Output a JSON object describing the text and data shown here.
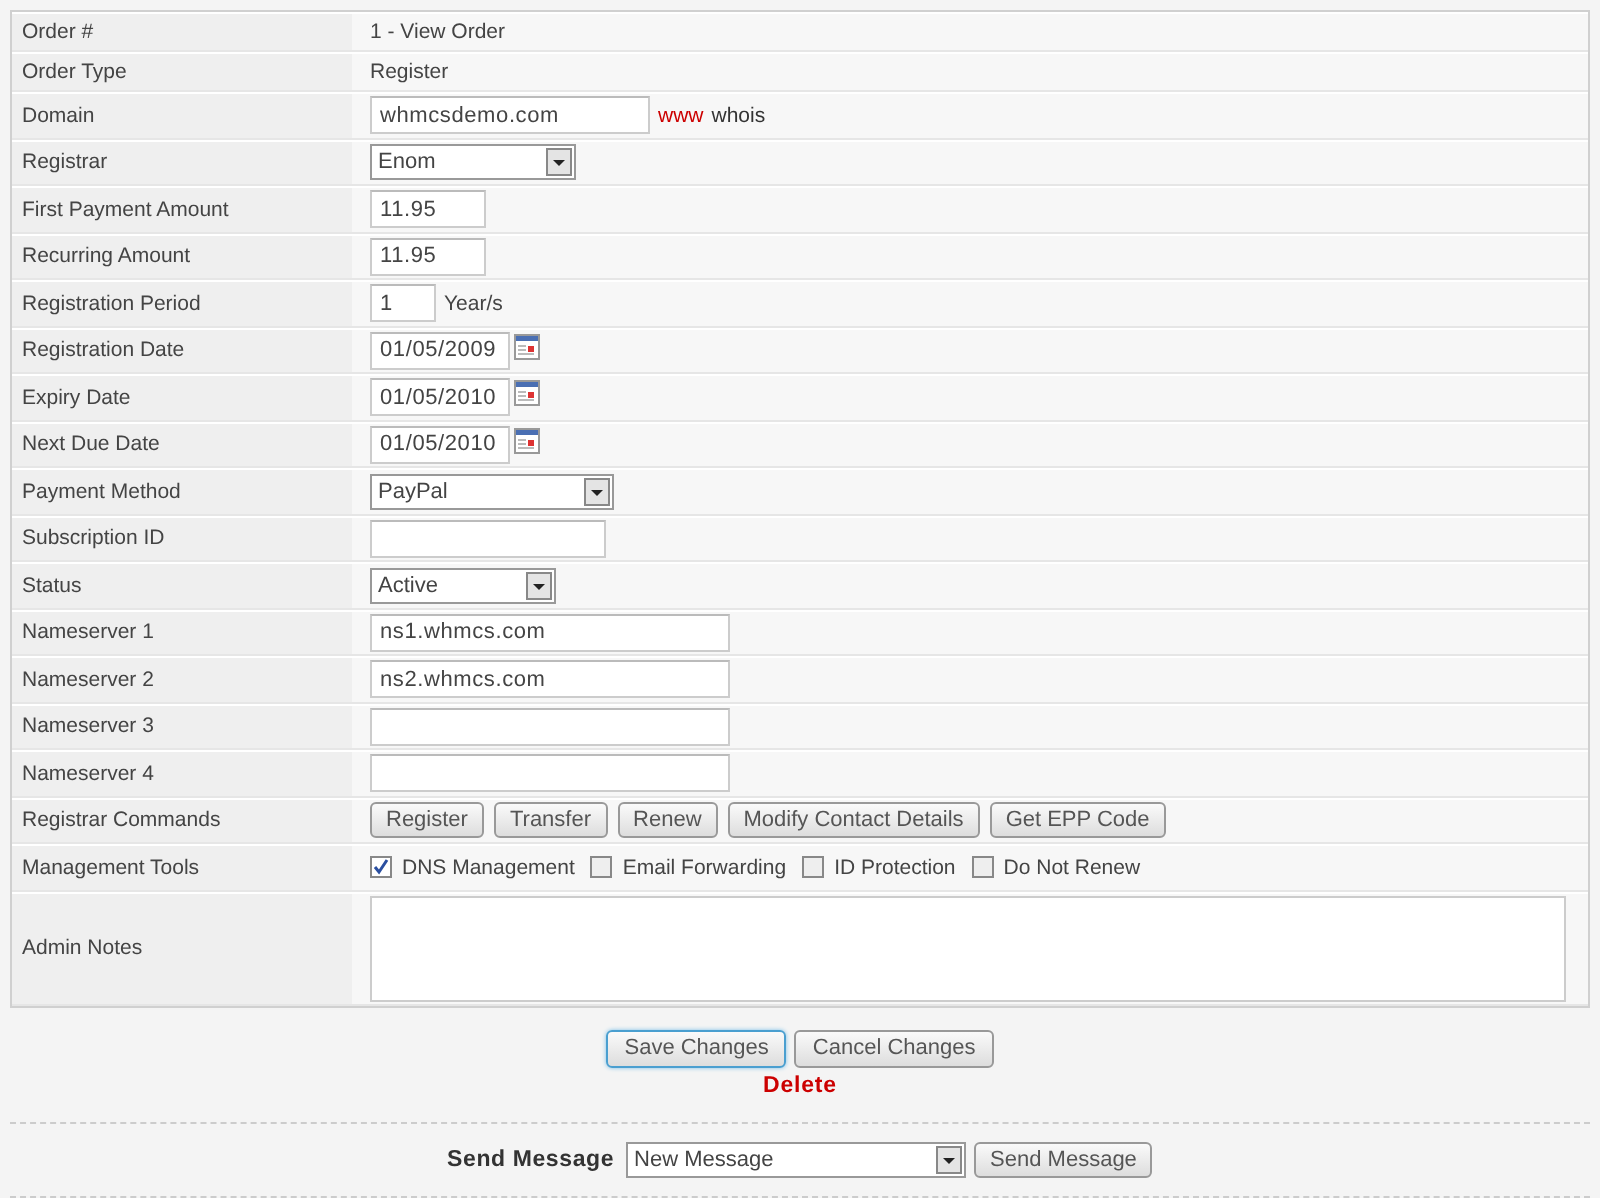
{
  "rows": [
    {
      "label": "Order #",
      "kind": "static",
      "value": "1 - View Order"
    },
    {
      "label": "Order Type",
      "kind": "static",
      "value": "Register"
    },
    {
      "label": "Domain",
      "kind": "domain",
      "value": "whmcsdemo.com",
      "links": [
        "www",
        "whois"
      ]
    },
    {
      "label": "Registrar",
      "kind": "select",
      "value": "Enom"
    },
    {
      "label": "First Payment Amount",
      "kind": "input",
      "value": "11.95"
    },
    {
      "label": "Recurring Amount",
      "kind": "input",
      "value": "11.95"
    },
    {
      "label": "Registration Period",
      "kind": "suffix",
      "value": "1",
      "suffix": "Year/s"
    },
    {
      "label": "Registration Date",
      "kind": "date",
      "value": "01/05/2009"
    },
    {
      "label": "Expiry Date",
      "kind": "date",
      "value": "01/05/2010"
    },
    {
      "label": "Next Due Date",
      "kind": "date",
      "value": "01/05/2010"
    },
    {
      "label": "Payment Method",
      "kind": "select",
      "value": "PayPal"
    },
    {
      "label": "Subscription ID",
      "kind": "input"
    },
    {
      "label": "Status",
      "kind": "select",
      "value": "Active"
    },
    {
      "label": "Nameserver 1",
      "kind": "input",
      "value": "ns1.whmcs.com"
    },
    {
      "label": "Nameserver 2",
      "kind": "input",
      "value": "ns2.whmcs.com"
    },
    {
      "label": "Nameserver 3",
      "kind": "input"
    },
    {
      "label": "Nameserver 4",
      "kind": "input"
    },
    {
      "label": "Registrar Commands",
      "kind": "buttons",
      "buttons": [
        "Register",
        "Transfer",
        "Renew",
        "Modify Contact Details",
        "Get EPP Code"
      ]
    },
    {
      "label": "Management Tools",
      "kind": "checkboxes",
      "options": [
        {
          "label": "DNS Management",
          "checked": true
        },
        {
          "label": "Email Forwarding",
          "checked": false
        },
        {
          "label": "ID Protection",
          "checked": false
        },
        {
          "label": "Do Not Renew",
          "checked": false
        }
      ]
    },
    {
      "label": "Admin Notes",
      "kind": "textarea"
    }
  ],
  "actions": [
    {
      "label": "Save Changes",
      "focused": true
    },
    {
      "label": "Cancel Changes",
      "focused": false
    }
  ],
  "delete_link": "Delete",
  "send_message": {
    "label": "Send Message",
    "value": "New Message",
    "button": "Send Message"
  }
}
